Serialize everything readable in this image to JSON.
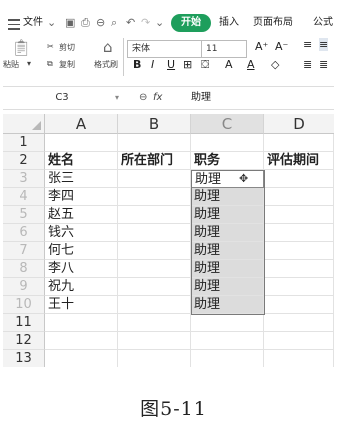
{
  "menubar": {
    "file_label": "文件",
    "tabs": [
      "开始",
      "插入",
      "页面布局",
      "公式"
    ]
  },
  "ribbon": {
    "paste_label": "粘贴",
    "cut_label": "剪切",
    "copy_label": "复制",
    "format_painter_label": "格式刷",
    "font_name": "宋体",
    "font_size": "11",
    "format_buttons": [
      "B",
      "I",
      "U"
    ]
  },
  "formula_bar": {
    "name_box": "C3",
    "fx_label": "fx",
    "value": "助理"
  },
  "sheet": {
    "columns": [
      "A",
      "B",
      "C",
      "D"
    ],
    "row_numbers": [
      "1",
      "2",
      "3",
      "4",
      "5",
      "6",
      "7",
      "8",
      "9",
      "10",
      "11",
      "12",
      "13"
    ],
    "headers": [
      "姓名",
      "所在部门",
      "职务",
      "评估期间"
    ],
    "names": [
      "张三",
      "李四",
      "赵五",
      "钱六",
      "何七",
      "李八",
      "祝九",
      "王十"
    ],
    "positions": [
      "助理",
      "助理",
      "助理",
      "助理",
      "助理",
      "助理",
      "助理",
      "助理"
    ]
  },
  "caption": "图5-11"
}
